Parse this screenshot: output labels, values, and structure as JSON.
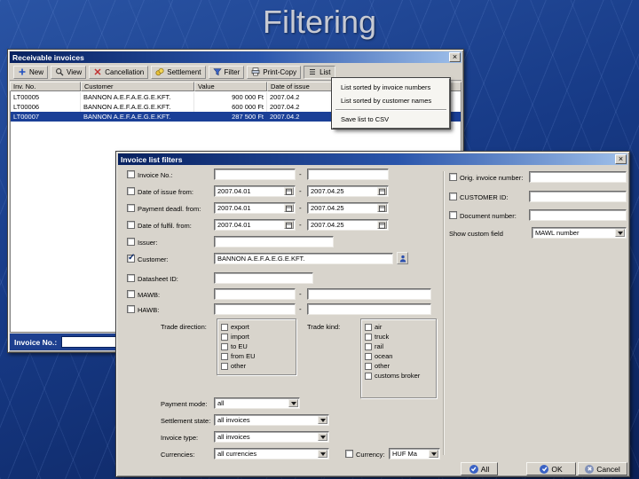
{
  "slide": {
    "title": "Filtering"
  },
  "colors": {
    "titlebar_gradient_start": "#08215f",
    "titlebar_gradient_end": "#9fc0ea",
    "selection_blue": "#1a3f97",
    "status_bar_blue": "#1d3f8f",
    "button_icon_blue": "#3a62c4"
  },
  "invoices_window": {
    "title": "Receivable invoices",
    "toolbar": {
      "new": "New",
      "view": "View",
      "cancellation": "Cancellation",
      "settlement": "Settlement",
      "filter": "Filter",
      "print_copy": "Print-Copy",
      "list": "List"
    },
    "columns": {
      "inv_no": "Inv. No.",
      "customer": "Customer",
      "value": "Value",
      "date": "Date of issue"
    },
    "rows": [
      {
        "inv_no": "LT00005",
        "customer": "BANNON A.E.F.A.E.G.E.KFT.",
        "value": "900 000 Ft",
        "date": "2007.04.2"
      },
      {
        "inv_no": "LT00006",
        "customer": "BANNON A.E.F.A.E.G.E.KFT.",
        "value": "600 000 Ft",
        "date": "2007.04.2"
      },
      {
        "inv_no": "LT00007",
        "customer": "BANNON A.E.F.A.E.G.E.KFT.",
        "value": "287 500 Ft",
        "date": "2007.04.2"
      }
    ],
    "list_menu": {
      "sorted_by_invoice": "List sorted by invoice numbers",
      "sorted_by_customer": "List sorted by customer names",
      "save_csv": "Save list to CSV"
    },
    "statusbar": {
      "invoice_no_label": "Invoice No.:",
      "invoice_no_value": ""
    }
  },
  "filters_dialog": {
    "title": "Invoice list filters",
    "dash": "-",
    "fields": {
      "invoice_no_label": "Invoice No.:",
      "invoice_no_from": "",
      "invoice_no_to": "",
      "date_of_issue_label": "Date of issue from:",
      "date_of_issue_from": "2007.04.01",
      "date_of_issue_to": "2007.04.25",
      "payment_deadline_label": "Payment deadl. from:",
      "payment_deadline_from": "2007.04.01",
      "payment_deadline_to": "2007.04.25",
      "fulfilment_label": "Date of fulfil. from:",
      "fulfilment_from": "2007.04.01",
      "fulfilment_to": "2007.04.25",
      "issuer_label": "Issuer:",
      "issuer_value": "",
      "customer_label": "Customer:",
      "customer_value": "BANNON A.E.F.A.E.G.E.KFT.",
      "datasheet_label": "Datasheet ID:",
      "datasheet_value": "",
      "mawb_label": "MAWB:",
      "hawb_label": "HAWB:"
    },
    "trade_direction": {
      "label": "Trade direction:",
      "options": [
        "export",
        "import",
        "to EU",
        "from EU",
        "other"
      ]
    },
    "trade_kind": {
      "label": "Trade kind:",
      "options": [
        "air",
        "truck",
        "rail",
        "ocean",
        "other",
        "customs broker"
      ]
    },
    "selects": {
      "payment_mode_label": "Payment mode:",
      "payment_mode_value": "all",
      "settlement_state_label": "Settlement state:",
      "settlement_state_value": "all invoices",
      "invoice_type_label": "Invoice type:",
      "invoice_type_value": "all invoices",
      "currencies_label": "Currencies:",
      "currencies_value": "all currencies",
      "currency_label": "Currency:",
      "currency_value": "HUF  Ma"
    },
    "right": {
      "orig_invoice_label": "Orig. invoice number:",
      "customer_id_label": "CUSTOMER ID:",
      "document_number_label": "Document number:",
      "show_custom_label": "Show custom field",
      "custom_field_value": "MAWL number"
    },
    "buttons": {
      "all": "All",
      "ok": "OK",
      "cancel": "Cancel"
    }
  }
}
